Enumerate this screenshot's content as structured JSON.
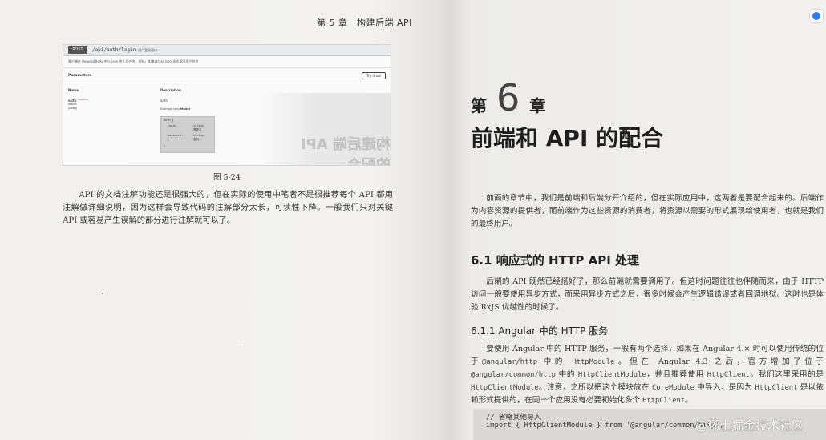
{
  "left_page": {
    "running_head": "第 5 章　构建后端 API",
    "screenshot": {
      "method": "POST",
      "path": "/api/auth/login",
      "summary": "用户登录接口",
      "description": "客户端在 RequestBody 中以 json 传入用户名、密码。如果成功以 json 形式返回用户信息",
      "parameters_title": "Parameters",
      "try_button": "Try it out",
      "col_name": "Name",
      "col_description": "Description",
      "param_name": "auth",
      "param_flag": "* required",
      "param_type": "object",
      "param_location": "(body)",
      "param_desc": "auth",
      "example_label": "Example Value",
      "model_label": "Model",
      "body_rows": [
        "Auth {",
        "login",
        "string",
        "登录名",
        "password",
        "string",
        "密码",
        "}"
      ]
    },
    "ghost_text": "构建后端 API 的配合",
    "caption": "图 5-24",
    "paragraph": "API 的文档注解功能还是很强大的，但在实际的使用中笔者不是很推荐每个 API 都用注解做详细说明，因为这样会导致代码的注解部分太长，可读性下降。一般我们只对关键 API 或容易产生误解的部分进行注解就可以了。"
  },
  "right_page": {
    "chapter_prefix": "第",
    "chapter_number": "6",
    "chapter_suffix": "章",
    "chapter_title": "前端和 API 的配合",
    "intro": "前面的章节中，我们是前端和后端分开介绍的，但在实际应用中，这两者是要配合起来的。后端作为内容资源的提供者，而前端作为这些资源的消费者，将资源以需要的形式展现给使用者，也就是我们的最终用户。",
    "section_6_1": "6.1  响应式的 HTTP API 处理",
    "section_6_1_body": "后端的 API 既然已经搭好了，那么前端就需要调用了。但这时问题往往也伴随而来，由于 HTTP 访问一般要使用异步方式，而采用异步方式之后，很多时候会产生逻辑错误或者回调地狱。这时也是体验 RxJS 优越性的时候了。",
    "section_6_1_1": "6.1.1  Angular 中的 HTTP 服务",
    "para_angular": {
      "t1": "要使用 Angular 中的 HTTP 服务，一般有两个选择，如果在 Angular 4.× 时可以使用传统的位于",
      "c1": "@angular/http",
      "t2": " 中的 ",
      "c2": "HttpModule",
      "t3": "。但在 Angular 4.3 之后，官方增加了位于",
      "c3": "@angular/common/http",
      "t4": " 中的 ",
      "c4": "HttpClientModule",
      "t5": "，并且推荐使用 ",
      "c5": "HttpClient",
      "t6": "。我们这里采用的是 ",
      "c6": "HttpClientModule",
      "t7": "。注意，之所以把这个模块放在 ",
      "c7": "CoreModule",
      "t8": " 中导入，是因为 ",
      "c8": "HttpClient",
      "t9": " 是以依赖形式提供的，在同一个应用没有必要初始化多个 ",
      "c9": "HttpClient",
      "t10": "。"
    },
    "code_comment": "// 省略其他导入",
    "code_import": "import { HttpClientModule } from '@angular/common/http';"
  },
  "watermark": "@稀土掘金技术社区"
}
